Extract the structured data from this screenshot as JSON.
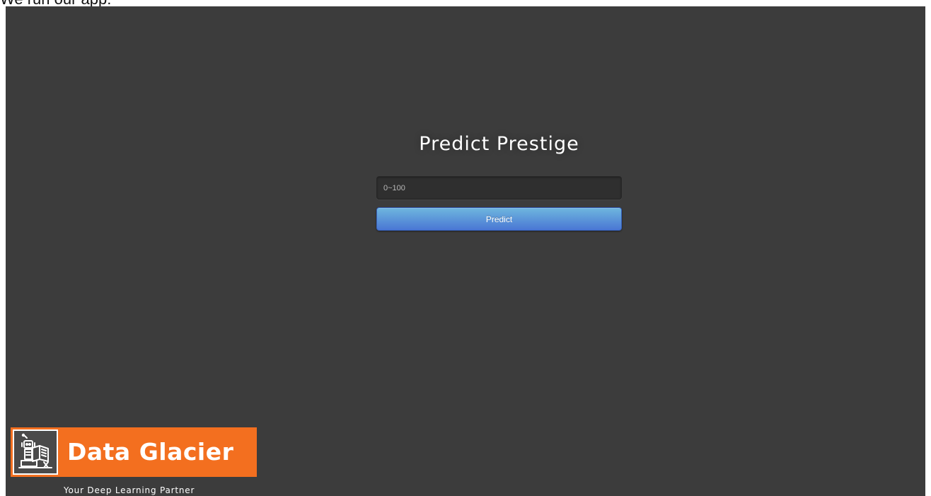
{
  "caption": "We run our app:",
  "app": {
    "title": "Predict Prestige",
    "input": {
      "placeholder": "0~100",
      "value": ""
    },
    "predict_button_label": "Predict"
  },
  "branding": {
    "name": "Data Glacier",
    "tagline": "Your Deep Learning Partner",
    "logo_icon": "robot-reading-book-icon",
    "colors": {
      "brand_orange": "#f36f1f",
      "background": "#3c3c3c",
      "button_top": "#6eb6de",
      "button_bottom": "#4a77d4"
    }
  }
}
